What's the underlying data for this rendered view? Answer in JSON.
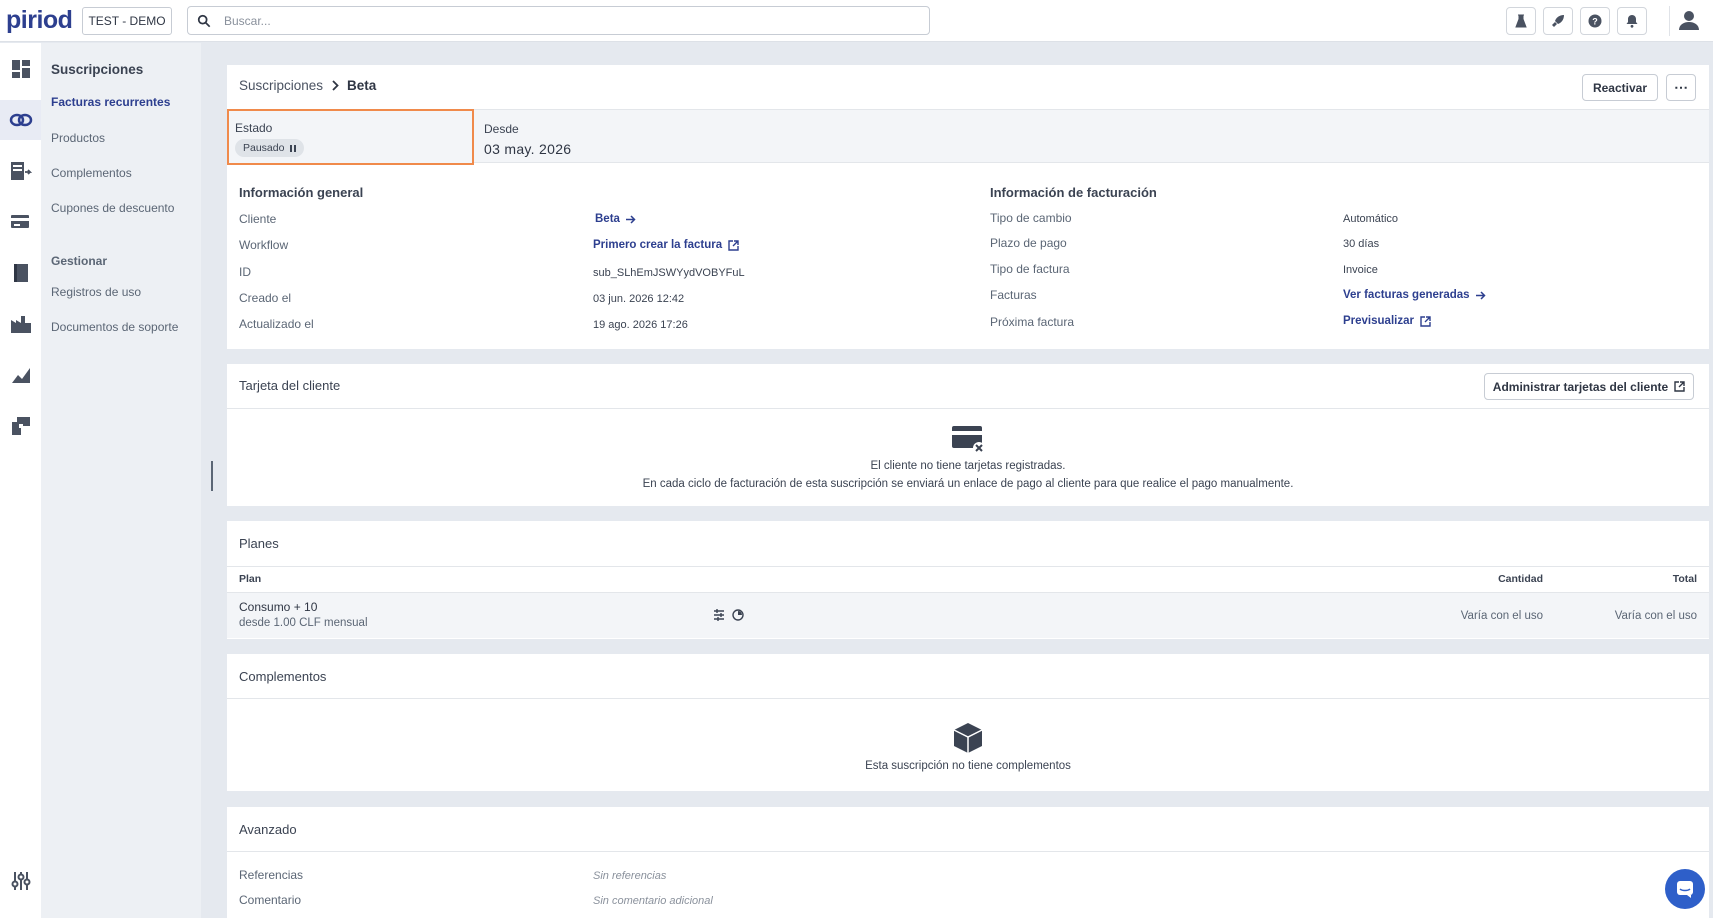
{
  "app": {
    "logo": "piriod",
    "environment": "TEST - DEMO"
  },
  "search": {
    "placeholder": "Buscar..."
  },
  "topbar_icons": [
    "flask-icon",
    "rocket-icon",
    "help-icon",
    "bell-icon",
    "user-avatar-icon"
  ],
  "rail_icons": [
    "dashboard-icon",
    "subscriptions-icon",
    "invoices-icon",
    "payments-icon",
    "catalog-icon",
    "integrations-icon",
    "reports-icon",
    "apps-icon",
    "settings-icon"
  ],
  "subnav": {
    "title": "Suscripciones",
    "items": [
      "Facturas recurrentes",
      "Productos",
      "Complementos",
      "Cupones de descuento"
    ],
    "section": "Gestionar",
    "manage_items": [
      "Registros de uso",
      "Documentos de soporte"
    ]
  },
  "header": {
    "breadcrumb_parent": "Suscripciones",
    "breadcrumb_current": "Beta",
    "reactivate_label": "Reactivar",
    "more_label": "⋯"
  },
  "status": {
    "estado_label": "Estado",
    "estado_value": "Pausado",
    "desde_label": "Desde",
    "desde_value": "03 may. 2026"
  },
  "general": {
    "title": "Información general",
    "cliente_label": "Cliente",
    "cliente_value": "Beta",
    "workflow_label": "Workflow",
    "workflow_value": "Primero crear la factura",
    "id_label": "ID",
    "id_value": "sub_SLhEmJSWYydVOBYFuL",
    "creado_label": "Creado el",
    "creado_value": "03 jun. 2026 12:42",
    "actualizado_label": "Actualizado el",
    "actualizado_value": "19 ago. 2026 17:26"
  },
  "billing": {
    "title": "Información de facturación",
    "tipo_cambio_label": "Tipo de cambio",
    "tipo_cambio_value": "Automático",
    "plazo_label": "Plazo de pago",
    "plazo_value": "30 días",
    "tipo_factura_label": "Tipo de factura",
    "tipo_factura_value": "Invoice",
    "facturas_label": "Facturas",
    "facturas_value": "Ver facturas generadas",
    "proxima_label": "Próxima factura",
    "proxima_value": "Previsualizar"
  },
  "card": {
    "title": "Tarjeta del cliente",
    "manage_label": "Administrar tarjetas del cliente",
    "empty_line1": "El cliente no tiene tarjetas registradas.",
    "empty_line2": "En cada ciclo de facturación de esta suscripción se enviará un enlace de pago al cliente para que realice el pago manualmente."
  },
  "plans": {
    "title": "Planes",
    "columns": {
      "plan": "Plan",
      "quantity": "Cantidad",
      "total": "Total"
    },
    "rows": [
      {
        "name": "Consumo + 10",
        "sub": "desde 1.00 CLF mensual",
        "quantity": "Varía con el uso",
        "total": "Varía con el uso"
      }
    ]
  },
  "addons": {
    "title": "Complementos",
    "empty": "Esta suscripción no tiene complementos"
  },
  "advanced": {
    "title": "Avanzado",
    "refs_label": "Referencias",
    "refs_value": "Sin referencias",
    "comment_label": "Comentario",
    "comment_value": "Sin comentario adicional"
  },
  "colors": {
    "brand": "#2d3f8f",
    "highlight": "#f08a4b",
    "chat": "#2e5fc9"
  }
}
